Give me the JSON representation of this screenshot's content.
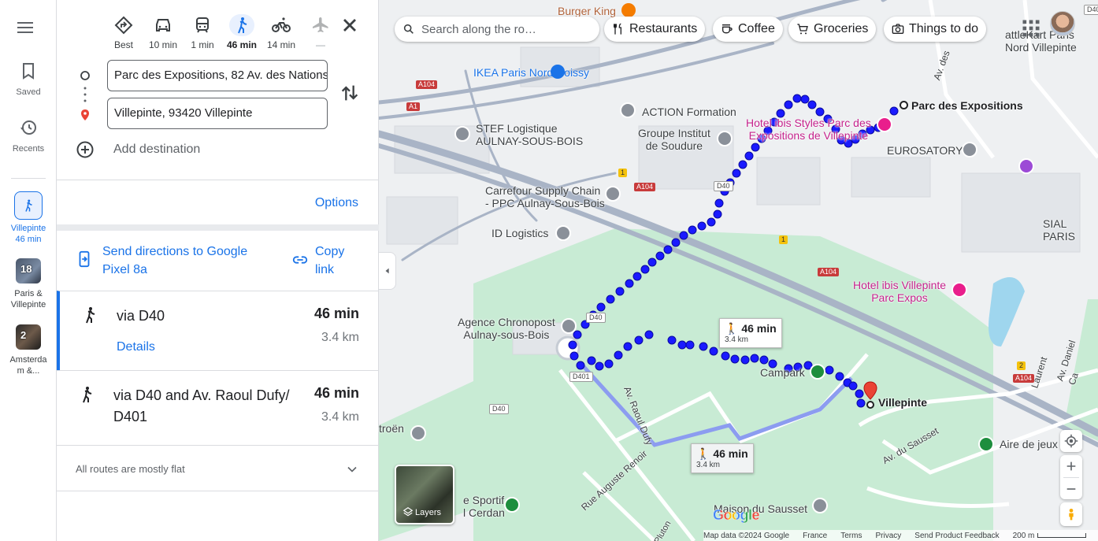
{
  "rail": {
    "saved_label": "Saved",
    "recents_label": "Recents",
    "trips": [
      {
        "line1": "Villepinte",
        "line2": "46 min"
      },
      {
        "badge": "18",
        "line1": "Paris &",
        "line2": "Villepinte"
      },
      {
        "badge": "2",
        "line1": "Amsterda",
        "line2": "m &..."
      }
    ]
  },
  "modes": [
    {
      "name": "best",
      "label": "Best"
    },
    {
      "name": "drive",
      "label": "10 min"
    },
    {
      "name": "transit",
      "label": "1 min"
    },
    {
      "name": "walk",
      "label": "46 min"
    },
    {
      "name": "bike",
      "label": "14 min"
    },
    {
      "name": "flight",
      "label": "—"
    }
  ],
  "waypoints": {
    "origin": "Parc des Expositions, 82 Av. des Nations",
    "destination": "Villepinte, 93420 Villepinte",
    "add_destination": "Add destination"
  },
  "options_label": "Options",
  "send": {
    "label": "Send directions to Google Pixel 8a"
  },
  "copy": {
    "label": "Copy link"
  },
  "routes": [
    {
      "via": "via D40",
      "time": "46 min",
      "distance": "3.4 km",
      "details": "Details"
    },
    {
      "via": "via D40 and Av. Raoul Dufy/ D401",
      "time": "46 min",
      "distance": "3.4 km"
    }
  ],
  "flat_note": "All routes are mostly flat",
  "map": {
    "search_placeholder": "Search along the ro…",
    "chips": [
      "Restaurants",
      "Coffee",
      "Groceries",
      "Things to do"
    ],
    "places": {
      "burger_king": "Burger King",
      "ikea": "IKEA Paris Nord Roissy",
      "stef": "STEF Logistique\nAULNAY-SOUS-BOIS",
      "action": "ACTION Formation",
      "groupe": "Groupe Institut\nde Soudure",
      "carrefour": "Carrefour Supply Chain\n- PPC Aulnay-Sous-Bois",
      "id_log": "ID Logistics",
      "chronopost": "Agence Chronopost\nAulnay-sous-Bois",
      "hotel_styles": "Hotel ibis Styles Parc des\nExpositions de Villepinte",
      "eurosatory": "EUROSATORY",
      "parc_expo": "Parc des Expositions",
      "sial": "SIAL PARIS",
      "hotel_ibis": "Hotel ibis Villepinte\nParc Expos",
      "campark": "Campark",
      "villepinte": "Villepinte",
      "aire": "Aire de jeux",
      "maison": "Maison du Sausset",
      "sportif": "e Sportif\nl Cerdan",
      "citroen": "troën",
      "kart": "attleKart Paris\nNord Villepinte",
      "av_des": "Av. des",
      "av_raoul": "Av. Raoul Dufy",
      "rue_auguste": "Rue Auguste Renoir",
      "av_sausset": "Av. du Sausset",
      "av_daniel": "Av. Daniel Ca",
      "laurent": "Laurent",
      "pluton": "Pluton"
    },
    "roads": {
      "a104": "A104",
      "a1": "A1",
      "d40": "D40",
      "d401": "D401",
      "one": "1",
      "two": "2"
    },
    "tooltip_main": {
      "time": "46 min",
      "dist": "3.4 km"
    },
    "tooltip_alt": {
      "time": "46 min",
      "dist": "3.4 km"
    },
    "layers_label": "Layers",
    "logo": "Google",
    "footer": {
      "mapdata": "Map data ©2024 Google",
      "country": "France",
      "terms": "Terms",
      "privacy": "Privacy",
      "feedback": "Send Product Feedback",
      "scale": "200 m"
    }
  },
  "colors": {
    "accent": "#1a73e8",
    "route": "#1a1aff",
    "park": "#c8ebd4",
    "map_bg": "#e9ecef",
    "poi_pink": "#c5228c"
  }
}
